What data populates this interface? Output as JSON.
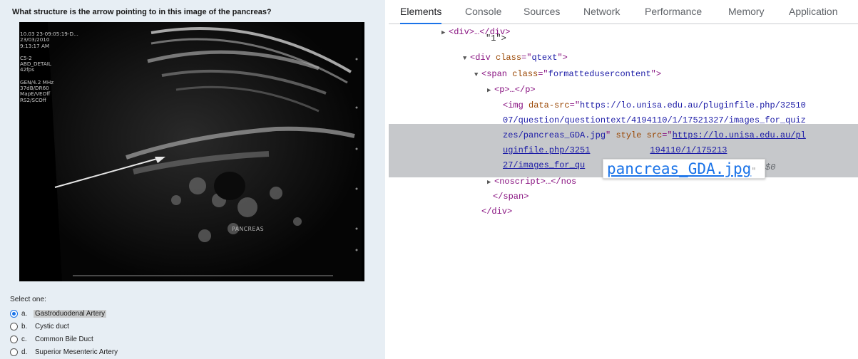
{
  "quiz": {
    "question": "What structure is the arrow pointing to in this image of the pancreas?",
    "image_overlay": {
      "lines_1": [
        "10.03 23-09:05:19-D...",
        "23/03/2010",
        "9:13:17 AM"
      ],
      "lines_2": [
        "C5-2",
        "ABD_DETAIL",
        "42fps"
      ],
      "lines_3": [
        "GEN/4.2 MHz",
        "37dB/DR60",
        "MapE/VEOff",
        "RS2/SCOff"
      ],
      "label": "PANCREAS"
    },
    "select_prompt": "Select one:",
    "options": [
      {
        "letter": "a.",
        "text": "Gastroduodenal Artery",
        "selected": true
      },
      {
        "letter": "b.",
        "text": "Cystic duct",
        "selected": false
      },
      {
        "letter": "c.",
        "text": "Common Bile Duct",
        "selected": false
      },
      {
        "letter": "d.",
        "text": "Superior Mesenteric Artery",
        "selected": false
      }
    ]
  },
  "devtools": {
    "tabs": [
      "Elements",
      "Console",
      "Sources",
      "Network",
      "Performance",
      "Memory",
      "Application"
    ],
    "active_tab": "Elements",
    "dom": {
      "div_collapsed": "<div>…</div>",
      "partial_text": "\"1\">",
      "div_tag": "div",
      "div_class": "qtext",
      "span_tag": "span",
      "span_class": "formattedusercontent",
      "p_collapsed": "<p>…</p>",
      "img_line1": "https://lo.unisa.edu.au/pluginfile.php/32510",
      "img_line2": "07/question/questiontext/4194110/1/17521327/images_for_quiz",
      "img_line3_a": "zes/pancreas_GDA.jpg",
      "img_line3_link": "https://lo.unisa.edu.au/pl",
      "img_line4_link_a": "uginfile.php/3251",
      "img_line4_link_b": "194110/1/175213",
      "img_line5_link": "27/images_for_qu",
      "noscript_collapsed": "<noscript>…</nos",
      "span_close": "</span>",
      "div_close": "</div>",
      "dollar_ref": "$0"
    },
    "tooltip": "pancreas_GDA.jpg"
  }
}
